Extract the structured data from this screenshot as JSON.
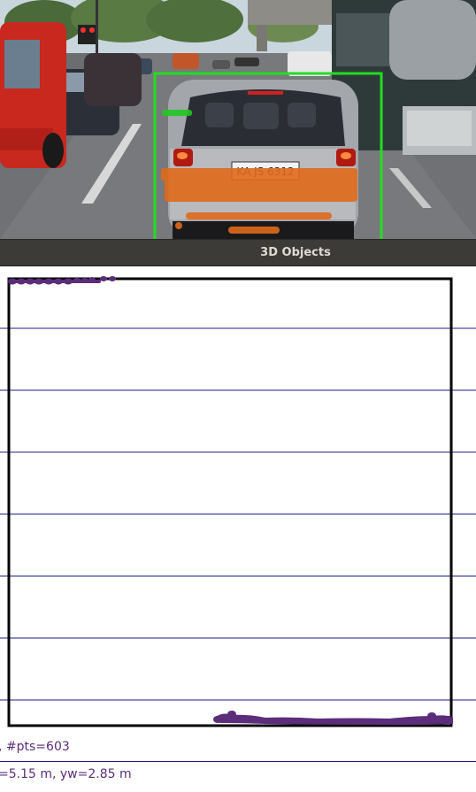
{
  "panel": {
    "title": "3D Objects"
  },
  "camera_view": {
    "license_plate": "KA JS 6312",
    "detection_box_color": "#22dd22",
    "lidar_projection_color": "#e06a1a"
  },
  "object_view": {
    "point_color": "#5b2d7a",
    "box_color": "#000000",
    "grid_color": "#1c1c8c",
    "points_label": ", #pts=603",
    "size_label": "=5.15 m, yw=2.85 m"
  }
}
